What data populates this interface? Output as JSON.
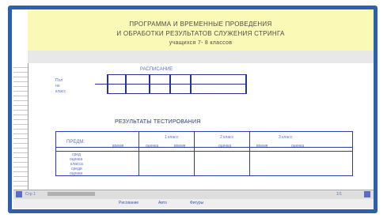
{
  "header": {
    "line1": "ПРОГРАММА И ВРЕМЕННЫЕ ПРОВЕДЕНИЯ",
    "line2": "И ОБРАБОТКИ РЕЗУЛЬТАТОВ СЛУЖЕНИЯ СТРИНГА",
    "line3": "учащихся 7- 8 классов"
  },
  "schedule": {
    "title": "РАСПИСАНИЕ",
    "row_labels": [
      "Пол",
      "нн",
      "класс"
    ]
  },
  "results": {
    "title": "РЕЗУЛЬТАТЫ ТЕСТИРОВАНИЯ",
    "first_col": "ПРЕДМ.",
    "groups": [
      "1 класс",
      "2 класс",
      "3 класс"
    ],
    "subcols": [
      "время",
      "оценка",
      "время",
      "оценка",
      "время",
      "оценка"
    ],
    "row_label_lines": [
      "сред",
      "оценка",
      "класса",
      "среди",
      "оценки"
    ]
  },
  "statusbar": {
    "left_text": "Стр 1",
    "right_text": "1/1"
  },
  "footer": {
    "items": [
      "Рисование",
      "Авто",
      "Фигуры"
    ]
  },
  "colors": {
    "frame": "#2c5fb0",
    "header_band": "#fbf9b6",
    "table_lines": "#2b3fa6",
    "text_blue": "#5c6fc4"
  }
}
